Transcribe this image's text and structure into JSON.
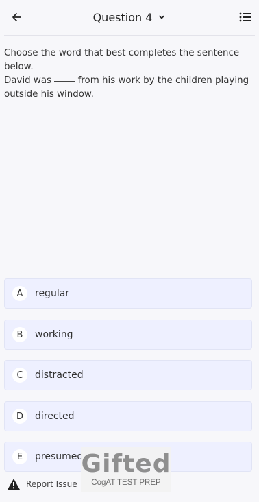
{
  "header": {
    "title": "Question 4",
    "back_icon": "arrow-left-icon",
    "dropdown_icon": "chevron-down-icon",
    "list_icon": "list-icon"
  },
  "question": {
    "instruction": "Choose the word that best completes the sentence below.",
    "sentence_before": "David was",
    "sentence_after": "from his work by the children playing outside his window."
  },
  "options": [
    {
      "letter": "A",
      "text": "regular"
    },
    {
      "letter": "B",
      "text": "working"
    },
    {
      "letter": "C",
      "text": "distracted"
    },
    {
      "letter": "D",
      "text": "directed"
    },
    {
      "letter": "E",
      "text": "presumed"
    }
  ],
  "footer": {
    "report_label": "Report Issue",
    "report_icon": "warning-icon"
  },
  "watermark": {
    "name": "Gifted",
    "tagline": "CogAT TEST PREP"
  },
  "colors": {
    "background": "#f7f7fa",
    "option_bg": "#eef0ff",
    "option_border": "#e1e4f5"
  }
}
